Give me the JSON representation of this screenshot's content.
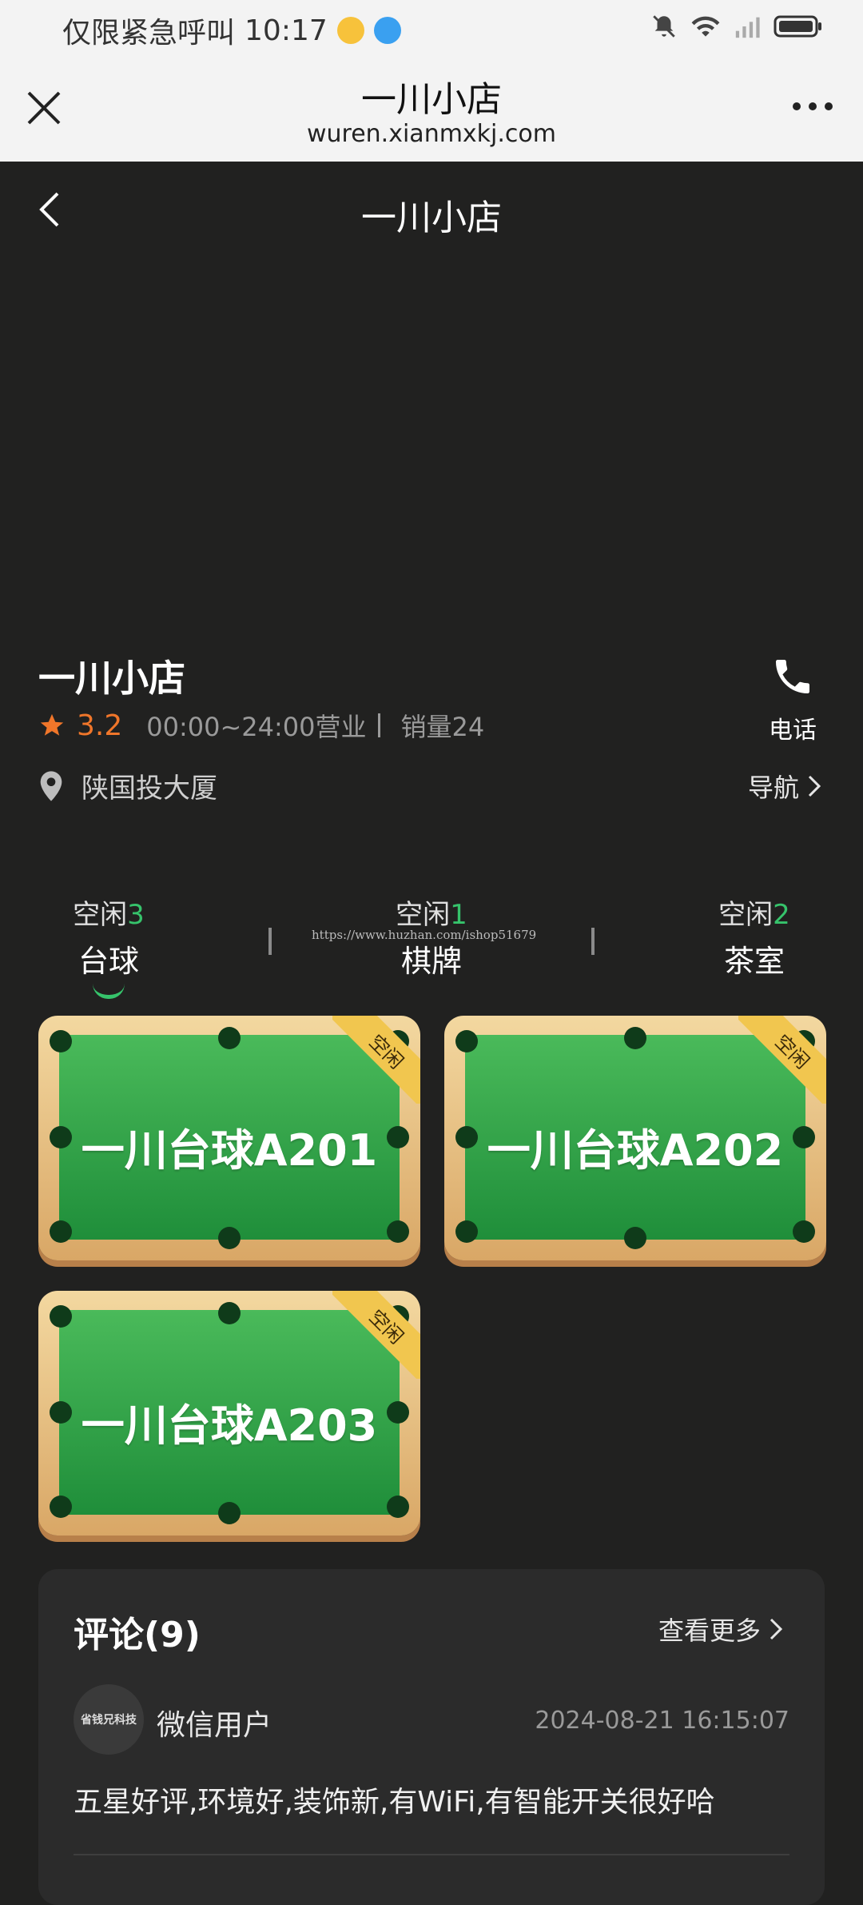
{
  "status_bar": {
    "carrier_text": "仅限紧急呼叫",
    "time": "10:17"
  },
  "web_header": {
    "title": "一川小店",
    "url": "wuren.xianmxkj.com"
  },
  "page_nav": {
    "title": "一川小店"
  },
  "shop": {
    "name": "一川小店",
    "rating": "3.2",
    "hours": "00:00~24:00营业",
    "sales": "销量24",
    "address": "陕国投大厦",
    "phone_label": "电话",
    "navigate_label": "导航"
  },
  "tabs": [
    {
      "idle_label": "空闲",
      "idle_count": "3",
      "name": "台球"
    },
    {
      "idle_label": "空闲",
      "idle_count": "1",
      "name": "棋牌"
    },
    {
      "idle_label": "空闲",
      "idle_count": "2",
      "name": "茶室"
    }
  ],
  "watermark": "https://www.huzhan.com/ishop51679",
  "tables": [
    {
      "name": "一川台球A201",
      "status": "空闲"
    },
    {
      "name": "一川台球A202",
      "status": "空闲"
    },
    {
      "name": "一川台球A203",
      "status": "空闲"
    }
  ],
  "comments": {
    "title": "评论(9)",
    "more_label": "查看更多",
    "items": [
      {
        "avatar_text": "省钱兄科技",
        "user": "微信用户",
        "date": "2024-08-21 16:15:07",
        "text": "五星好评,环境好,装饰新,有WiFi,有智能开关很好哈"
      }
    ]
  },
  "colors": {
    "accent_green": "#36c36b",
    "rating_orange": "#f0762a",
    "background": "#212120"
  }
}
